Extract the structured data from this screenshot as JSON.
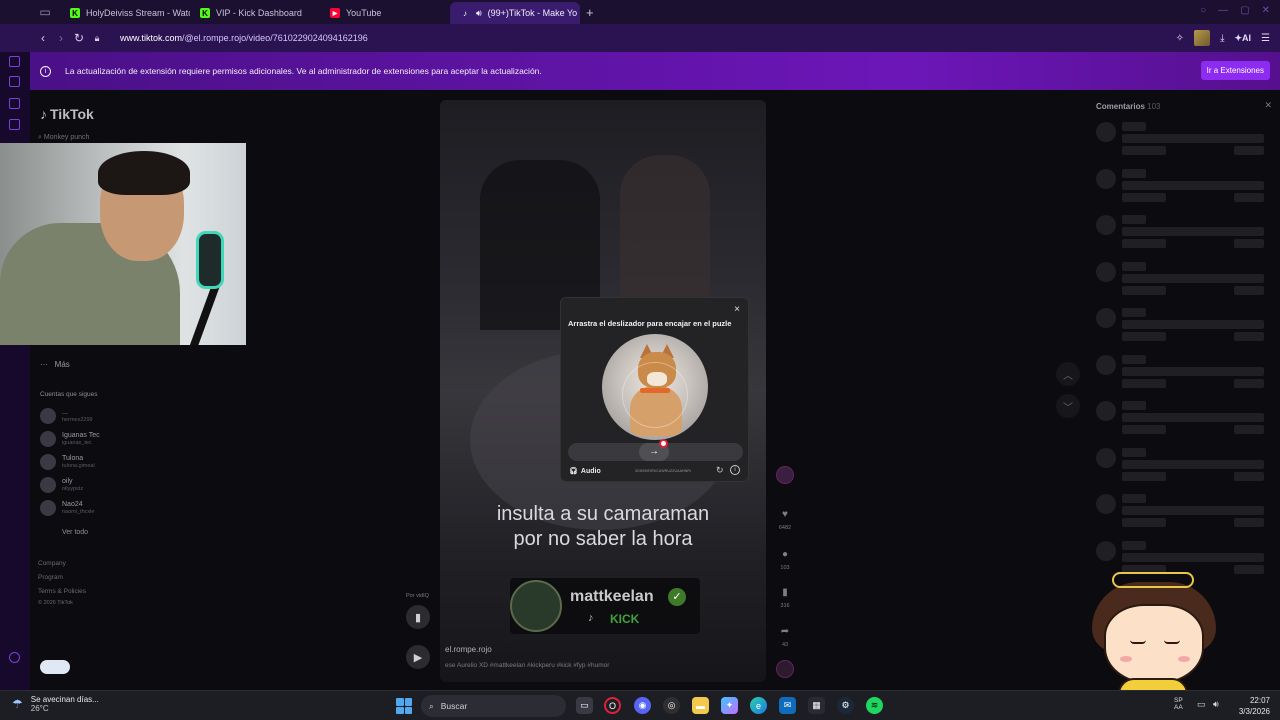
{
  "browser": {
    "tabs": [
      {
        "label": "HolyDeiviss Stream - Watc",
        "icon": "kick-icon",
        "color": "#53fc18"
      },
      {
        "label": "VIP - Kick Dashboard",
        "icon": "kick-icon",
        "color": "#53fc18"
      },
      {
        "label": "YouTube",
        "icon": "youtube-icon",
        "color": "#ff0033"
      },
      {
        "label": "(99+)TikTok - Make Yo",
        "icon": "tiktok-icon",
        "color": "#ffffff",
        "active": true
      }
    ],
    "url_host": "www.tiktok.com",
    "url_path": "/@el.rompe.rojo/video/7610229024094162196",
    "ai_label": "AI"
  },
  "info_bar": {
    "message": "La actualización de extensión requiere permisos adicionales. Ve al administrador de extensiones para aceptar la actualización.",
    "button": "Ir a Extensiones"
  },
  "tiktok": {
    "logo": "TikTok",
    "search_placeholder": "Monkey punch",
    "more": "Más",
    "following_header": "Cuentas que sigues",
    "following": [
      {
        "name": "...",
        "handle": "hermes2299"
      },
      {
        "name": "Iguanas Tec",
        "handle": "iguanas_tec"
      },
      {
        "name": "Tulona",
        "handle": "tulona.gimeal"
      },
      {
        "name": "oily",
        "handle": "oilyypstz"
      },
      {
        "name": "Nao24",
        "handle": "naomi_thcxle"
      }
    ],
    "see_all": "Ver todo",
    "footer": [
      "Company",
      "Program",
      "Terms & Policies",
      "© 2026 TikTok"
    ]
  },
  "video": {
    "caption_line1": "insulta a su camaraman",
    "caption_line2": "por no saber la hora",
    "creator_badge_name": "mattkeelan",
    "creator_badge_platform": "KICK",
    "author": "el.rompe.rojo",
    "description": "ese Aurelio XD #mattkeelan #kickperu #kick #fyp #humor",
    "playback_label": "Por vidIQ",
    "likes": "6482",
    "comments": "103",
    "saves": "316",
    "shares": "43"
  },
  "comments_panel": {
    "title": "Comentarios",
    "count": "103"
  },
  "captcha": {
    "title": "Arrastra el deslizador para encajar en el puzle",
    "audio_label": "Audio",
    "code": "3GNSHEIRKCUWRUZZUAAHNRI",
    "close": "×",
    "slider_arrow": "→"
  },
  "taskbar": {
    "weather_text": "Se avecinan días...",
    "temperature": "26°C",
    "search_label": "Buscar",
    "lang_top": "SP",
    "lang_bottom": "AA",
    "time": "22:07",
    "date": "3/3/2026"
  }
}
